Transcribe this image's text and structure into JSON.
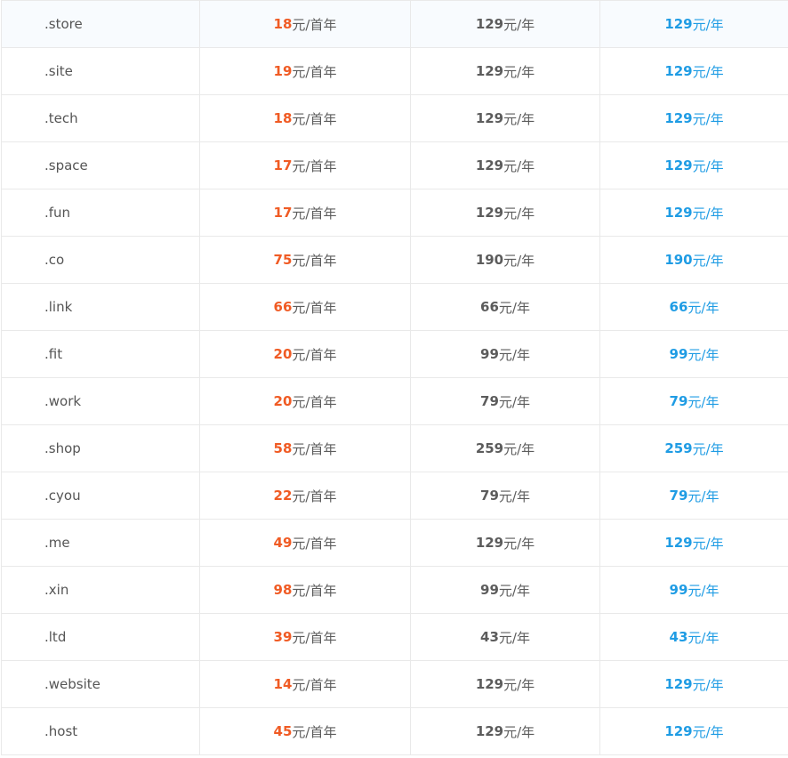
{
  "units": {
    "first_year": "元/首年",
    "per_year": "元/年"
  },
  "colors": {
    "first_year_price": "#f05b24",
    "renewal_price": "#5c5c5c",
    "transfer_price": "#1f9ce4",
    "border": "#e9e9e9"
  },
  "rows": [
    {
      "tld": ".store",
      "first": "18",
      "renew": "129",
      "transfer": "129"
    },
    {
      "tld": ".site",
      "first": "19",
      "renew": "129",
      "transfer": "129"
    },
    {
      "tld": ".tech",
      "first": "18",
      "renew": "129",
      "transfer": "129"
    },
    {
      "tld": ".space",
      "first": "17",
      "renew": "129",
      "transfer": "129"
    },
    {
      "tld": ".fun",
      "first": "17",
      "renew": "129",
      "transfer": "129"
    },
    {
      "tld": ".co",
      "first": "75",
      "renew": "190",
      "transfer": "190"
    },
    {
      "tld": ".link",
      "first": "66",
      "renew": "66",
      "transfer": "66"
    },
    {
      "tld": ".fit",
      "first": "20",
      "renew": "99",
      "transfer": "99"
    },
    {
      "tld": ".work",
      "first": "20",
      "renew": "79",
      "transfer": "79"
    },
    {
      "tld": ".shop",
      "first": "58",
      "renew": "259",
      "transfer": "259"
    },
    {
      "tld": ".cyou",
      "first": "22",
      "renew": "79",
      "transfer": "79"
    },
    {
      "tld": ".me",
      "first": "49",
      "renew": "129",
      "transfer": "129"
    },
    {
      "tld": ".xin",
      "first": "98",
      "renew": "99",
      "transfer": "99"
    },
    {
      "tld": ".ltd",
      "first": "39",
      "renew": "43",
      "transfer": "43"
    },
    {
      "tld": ".website",
      "first": "14",
      "renew": "129",
      "transfer": "129"
    },
    {
      "tld": ".host",
      "first": "45",
      "renew": "129",
      "transfer": "129"
    }
  ]
}
